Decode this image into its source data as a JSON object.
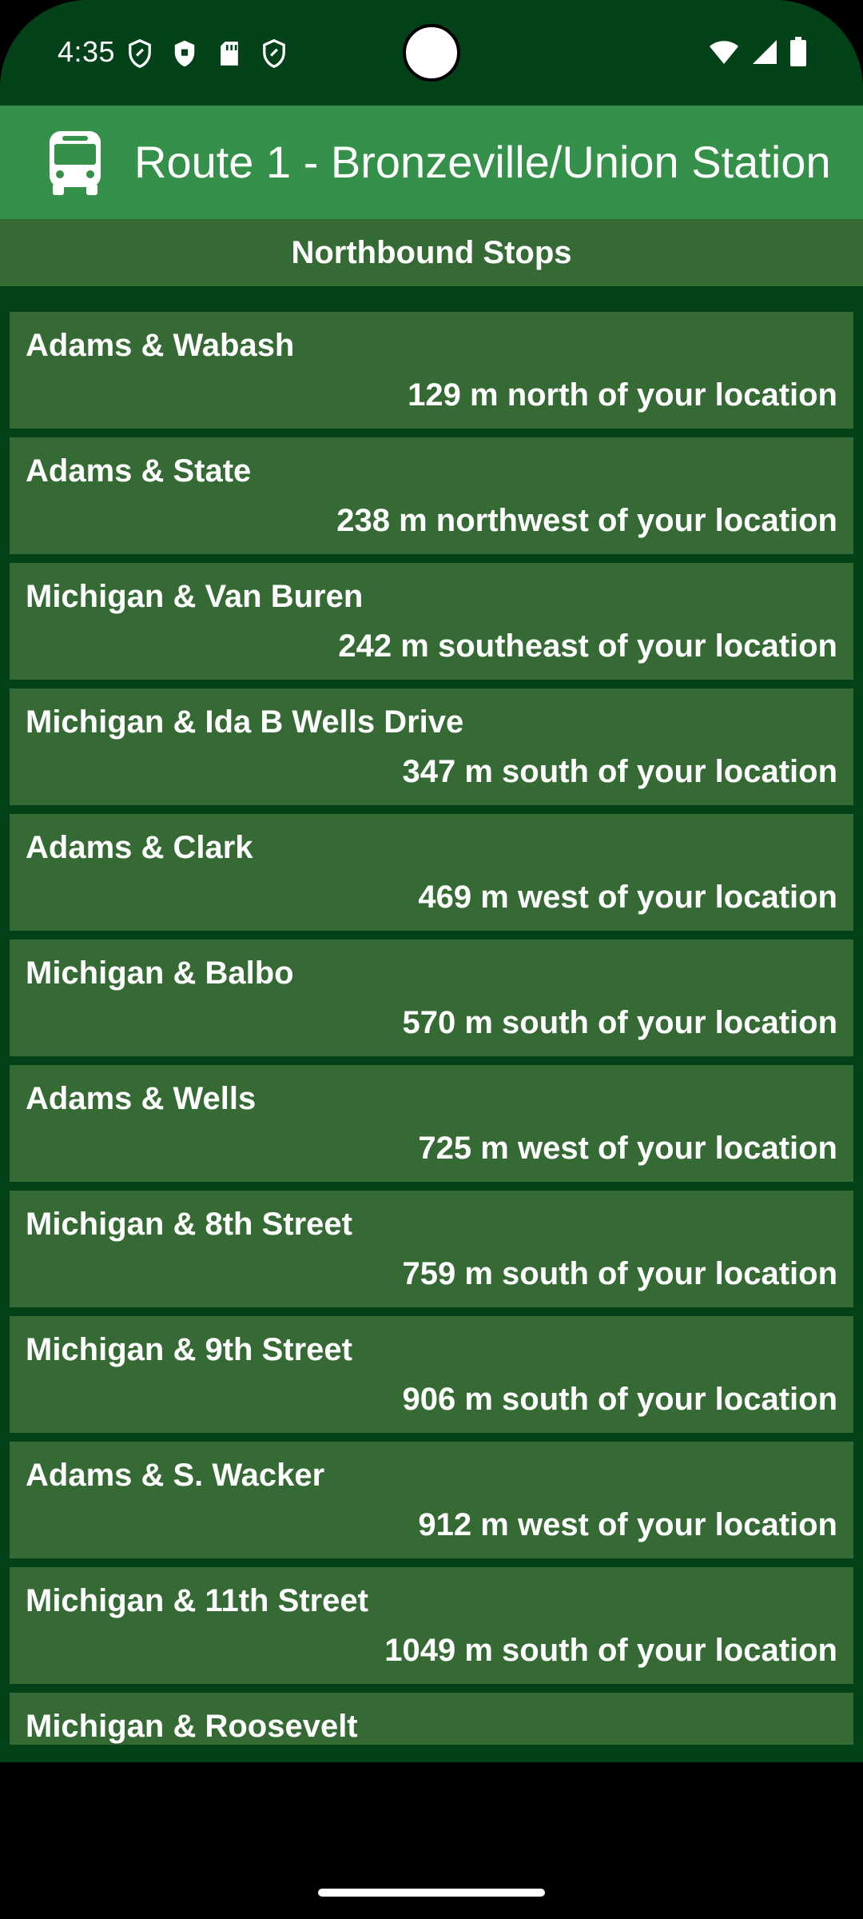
{
  "status_bar": {
    "time": "4:35",
    "left_icons": [
      "shield-outline-icon",
      "shield-filled-icon",
      "sd-card-icon",
      "shield-outline-icon"
    ],
    "right_icons": [
      "wifi-icon",
      "cell-signal-icon",
      "battery-icon"
    ]
  },
  "app_bar": {
    "icon": "bus-icon",
    "title": "Route 1 - Bronzeville/Union Station"
  },
  "section": {
    "title": "Northbound Stops"
  },
  "stops": [
    {
      "name": "Adams & Wabash",
      "distance": "129 m north of your location"
    },
    {
      "name": "Adams & State",
      "distance": "238 m northwest of your location"
    },
    {
      "name": "Michigan & Van Buren",
      "distance": "242 m southeast of your location"
    },
    {
      "name": "Michigan & Ida B Wells Drive",
      "distance": "347 m south of your location"
    },
    {
      "name": "Adams & Clark",
      "distance": "469 m west of your location"
    },
    {
      "name": "Michigan & Balbo",
      "distance": "570 m south of your location"
    },
    {
      "name": "Adams & Wells",
      "distance": "725 m west of your location"
    },
    {
      "name": "Michigan & 8th Street",
      "distance": "759 m south of your location"
    },
    {
      "name": "Michigan & 9th Street",
      "distance": "906 m south of your location"
    },
    {
      "name": "Adams & S. Wacker",
      "distance": "912 m west of your location"
    },
    {
      "name": "Michigan & 11th Street",
      "distance": "1049 m south of your location"
    },
    {
      "name": "Michigan & Roosevelt",
      "distance": ""
    }
  ],
  "colors": {
    "background": "#034219",
    "app_bar": "#35914a",
    "list_item": "#366a35",
    "text": "#ffffff"
  }
}
